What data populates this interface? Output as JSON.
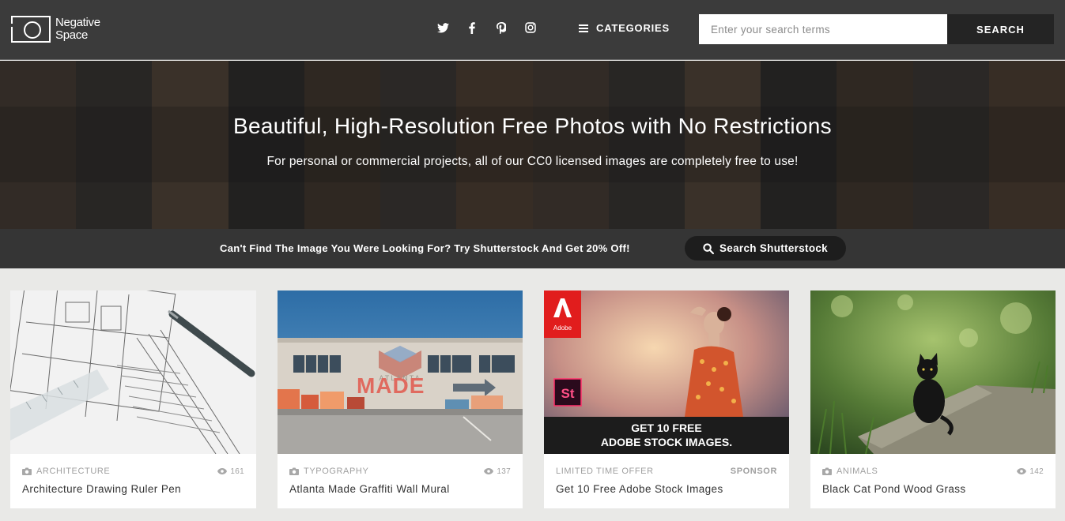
{
  "header": {
    "logo_line1": "Negative",
    "logo_line2": "Space",
    "social_icons": [
      "twitter-icon",
      "facebook-icon",
      "pinterest-icon",
      "instagram-icon"
    ],
    "categories_label": "CATEGORIES",
    "search_placeholder": "Enter your search terms",
    "search_button": "SEARCH"
  },
  "hero": {
    "title": "Beautiful, High-Resolution Free Photos with No Restrictions",
    "subtitle": "For personal or commercial projects, all of our CC0 licensed images are completely free to use!"
  },
  "promo": {
    "text": "Can't Find The Image You Were Looking For? Try Shutterstock And Get 20% Off!",
    "button": "Search Shutterstock"
  },
  "cards": [
    {
      "category": "ARCHITECTURE",
      "views": "161",
      "title": "Architecture Drawing Ruler Pen"
    },
    {
      "category": "TYPOGRAPHY",
      "views": "137",
      "title": "Atlanta Made Graffiti Wall Mural",
      "mural_text_top": "ATLANTA",
      "mural_text": "MADE"
    },
    {
      "category": "LIMITED TIME OFFER",
      "sponsor": "SPONSOR",
      "title": "Get 10 Free Adobe Stock Images",
      "ad_brand": "Adobe",
      "ad_app": "St",
      "ad_line1": "GET 10 FREE",
      "ad_line2": "ADOBE STOCK IMAGES."
    },
    {
      "category": "ANIMALS",
      "views": "142",
      "title": "Black Cat Pond Wood Grass"
    }
  ],
  "colors": {
    "header_bg": "#3b3b3b",
    "promo_bg": "#353535",
    "page_bg": "#e9e9e7",
    "adobe_red": "#e11d1d"
  }
}
